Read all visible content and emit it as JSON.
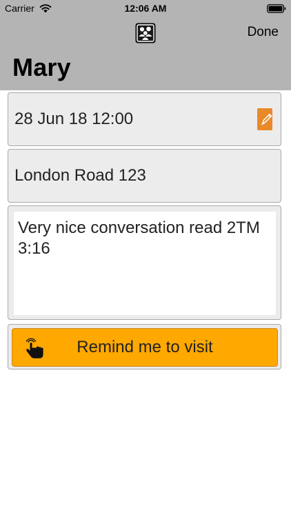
{
  "status_bar": {
    "carrier": "Carrier",
    "time": "12:06 AM"
  },
  "nav": {
    "icon": "contacts-icon",
    "done_label": "Done",
    "title": "Mary"
  },
  "visit": {
    "date": "28 Jun 18 12:00",
    "edit_icon": "edit-icon",
    "address": "London Road 123",
    "notes": "Very nice conversation read 2TM 3:16",
    "remind_label": "Remind me to visit",
    "remind_icon": "hand-pointer-icon"
  },
  "colors": {
    "nav_background": "#b4b4b4",
    "accent_orange": "#ffa800",
    "edit_icon_orange": "#e8892a"
  }
}
